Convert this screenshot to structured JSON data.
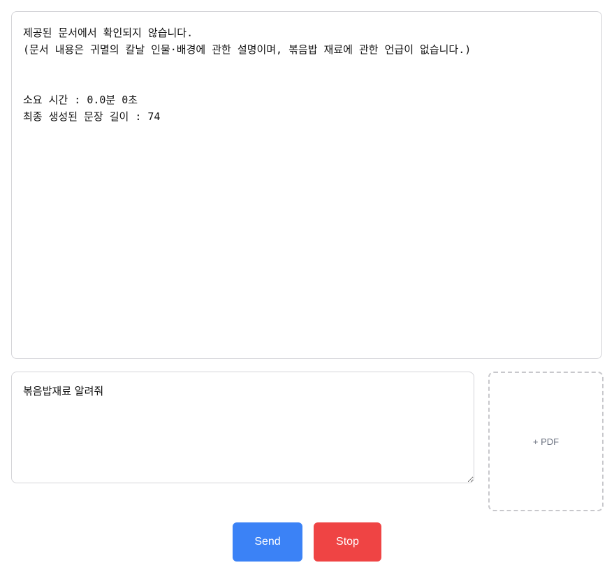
{
  "output": {
    "lines": [
      "제공된 문서에서 확인되지 않습니다.",
      "(문서 내용은 귀멸의 칼날 인물·배경에 관한 설명이며, 볶음밥 재료에 관한 언급이 없습니다.)"
    ],
    "elapsed_label": "소요 시간 : 0.0분 0초",
    "length_label": "최종 생성된 문장 길이 : 74"
  },
  "prompt": {
    "value": "볶음밥재료 알려줘"
  },
  "pdf_upload": {
    "label": "+ PDF"
  },
  "buttons": {
    "send_label": "Send",
    "stop_label": "Stop"
  },
  "colors": {
    "send": "#3b82f6",
    "stop": "#ef4444",
    "border": "#d4d4d8"
  }
}
